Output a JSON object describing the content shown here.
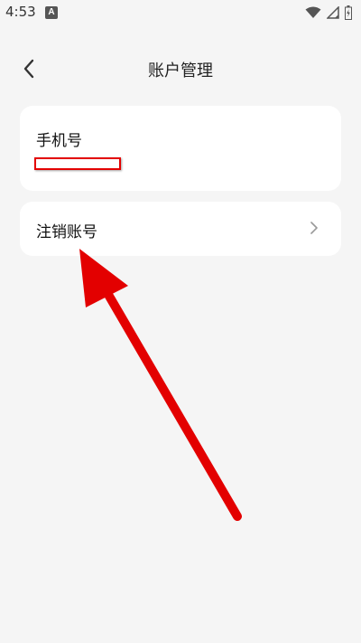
{
  "status_bar": {
    "time": "4:53",
    "app_badge": "A"
  },
  "header": {
    "title": "账户管理"
  },
  "account_phone": {
    "label": "手机号"
  },
  "cancel_account": {
    "label": "注销账号"
  },
  "icons": {
    "back": "chevron-left-icon",
    "wifi": "wifi-icon",
    "signal": "signal-icon",
    "battery": "battery-icon",
    "row_chevron": "chevron-right-icon"
  },
  "colors": {
    "background": "#f5f5f5",
    "card": "#ffffff",
    "annotation_red": "#e30000"
  }
}
